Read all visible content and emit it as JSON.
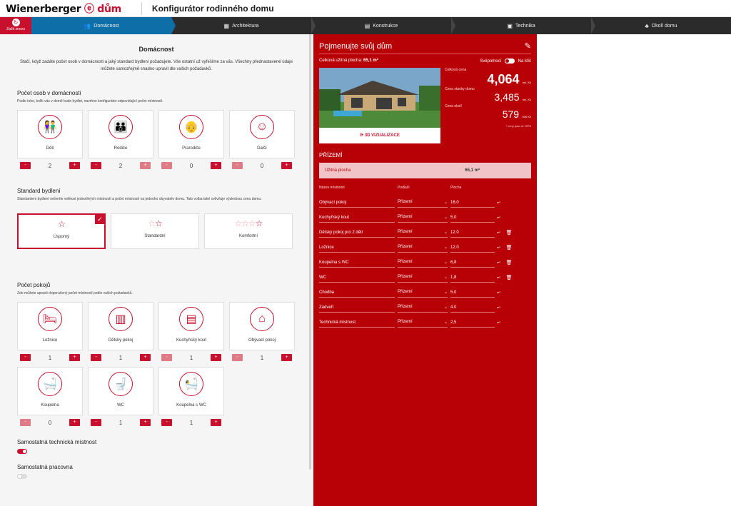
{
  "header": {
    "logo_text": "Wienerberger",
    "logo_suffix": "dům",
    "title": "Konfigurátor rodinného domu"
  },
  "nav": {
    "reset_label": "Začít znovu",
    "steps": [
      {
        "label": "Domácnost",
        "icon": "people-icon"
      },
      {
        "label": "Architektura",
        "icon": "building-icon"
      },
      {
        "label": "Konstrukce",
        "icon": "brick-icon"
      },
      {
        "label": "Technika",
        "icon": "device-icon"
      },
      {
        "label": "Okolí domu",
        "icon": "tree-icon"
      }
    ]
  },
  "left": {
    "heading": "Domácnost",
    "intro": "Stačí, když zadáte počet osob v domácnosti a jaký standard bydlení požadujete. Vše ostatní už vyřešíme za vás. Všechny přednastavené údaje můžete samozřejmě snadno upravit dle vašich požadavků.",
    "persons": {
      "title": "Počet osob v domácnosti",
      "desc": "Podle toho, kolik vás v domě bude bydlet, navrhne konfigurátor odpovídající počet místností.",
      "items": [
        {
          "label": "Děti",
          "value": "2"
        },
        {
          "label": "Rodiče",
          "value": "2"
        },
        {
          "label": "Prarodiče",
          "value": "0"
        },
        {
          "label": "Další",
          "value": "0"
        }
      ]
    },
    "standard": {
      "title": "Standard bydlení",
      "desc": "Standardem bydlení ovlivníte velikost jednotlivých místností a počet místností na jednoho obyvatele domu. Tato volba také ovlivňuje výslednou cenu domu.",
      "options": [
        {
          "label": "Úsporný",
          "stars": 1,
          "selected": true
        },
        {
          "label": "Standardní",
          "stars": 2,
          "selected": false
        },
        {
          "label": "Komfortní",
          "stars": 3,
          "selected": false
        }
      ]
    },
    "rooms": {
      "title": "Počet pokojů",
      "desc": "Zde můžete upravit doporučený počet místností podle vašich požadavků.",
      "items": [
        {
          "label": "Ložnice",
          "value": "1"
        },
        {
          "label": "Dětský pokoj",
          "value": "1"
        },
        {
          "label": "Kuchyňský kout",
          "value": "1"
        },
        {
          "label": "Obývací pokoj",
          "value": "1"
        },
        {
          "label": "Koupelna",
          "value": "0"
        },
        {
          "label": "WC",
          "value": "1"
        },
        {
          "label": "Koupelna s WC",
          "value": "1"
        }
      ]
    },
    "toggles": [
      {
        "label": "Samostatná technická místnost",
        "on": true
      },
      {
        "label": "Samostatná pracovna",
        "on": false
      }
    ]
  },
  "right": {
    "title": "Pojmenujte svůj dům",
    "area_label": "Celková užitná plocha:",
    "area_value": "65,1 m²",
    "svepomoci": "Svépomocí",
    "na_klic": "Na klíč",
    "viz_label": "3D VIZUALIZACE",
    "prices": {
      "total_label": "Celková cena",
      "total_value": "4,064",
      "total_unit": "mil. Kč",
      "build_label": "Cena stavby domu",
      "build_value": "3,485",
      "build_unit": "mil. Kč",
      "surround_label": "Cena okolí",
      "surround_value": "579",
      "surround_unit": "000 Kč",
      "note": "* ceny jsou vč. DPH"
    },
    "floor_title": "PŘÍZEMÍ",
    "usable_label": "Užitná plocha",
    "usable_value": "65,1 m²",
    "cols": {
      "name": "Název místnosti",
      "floor": "Podlaží",
      "area": "Plocha"
    },
    "rooms": [
      {
        "name": "Obývací pokoj",
        "floor": "Přízemí",
        "area": "16.0",
        "trash": false
      },
      {
        "name": "Kuchyňský kout",
        "floor": "Přízemí",
        "area": "5.0",
        "trash": false
      },
      {
        "name": "Dětský pokoj pro 2 děti",
        "floor": "Přízemí",
        "area": "12.0",
        "trash": true
      },
      {
        "name": "Ložnice",
        "floor": "Přízemí",
        "area": "12.0",
        "trash": true
      },
      {
        "name": "Koupelna s WC",
        "floor": "Přízemí",
        "area": "6,8",
        "trash": true
      },
      {
        "name": "WC",
        "floor": "Přízemí",
        "area": "1,8",
        "trash": true
      },
      {
        "name": "Chodba",
        "floor": "Přízemí",
        "area": "5.0",
        "trash": false
      },
      {
        "name": "Zádveří",
        "floor": "Přízemí",
        "area": "4.0",
        "trash": false
      },
      {
        "name": "Technická místnost",
        "floor": "Přízemí",
        "area": "2,5",
        "trash": false
      }
    ],
    "unit": "m²"
  },
  "colors": {
    "brand_red": "#c8102e",
    "panel_red": "#b80007",
    "nav_active": "#0e6ea8"
  }
}
